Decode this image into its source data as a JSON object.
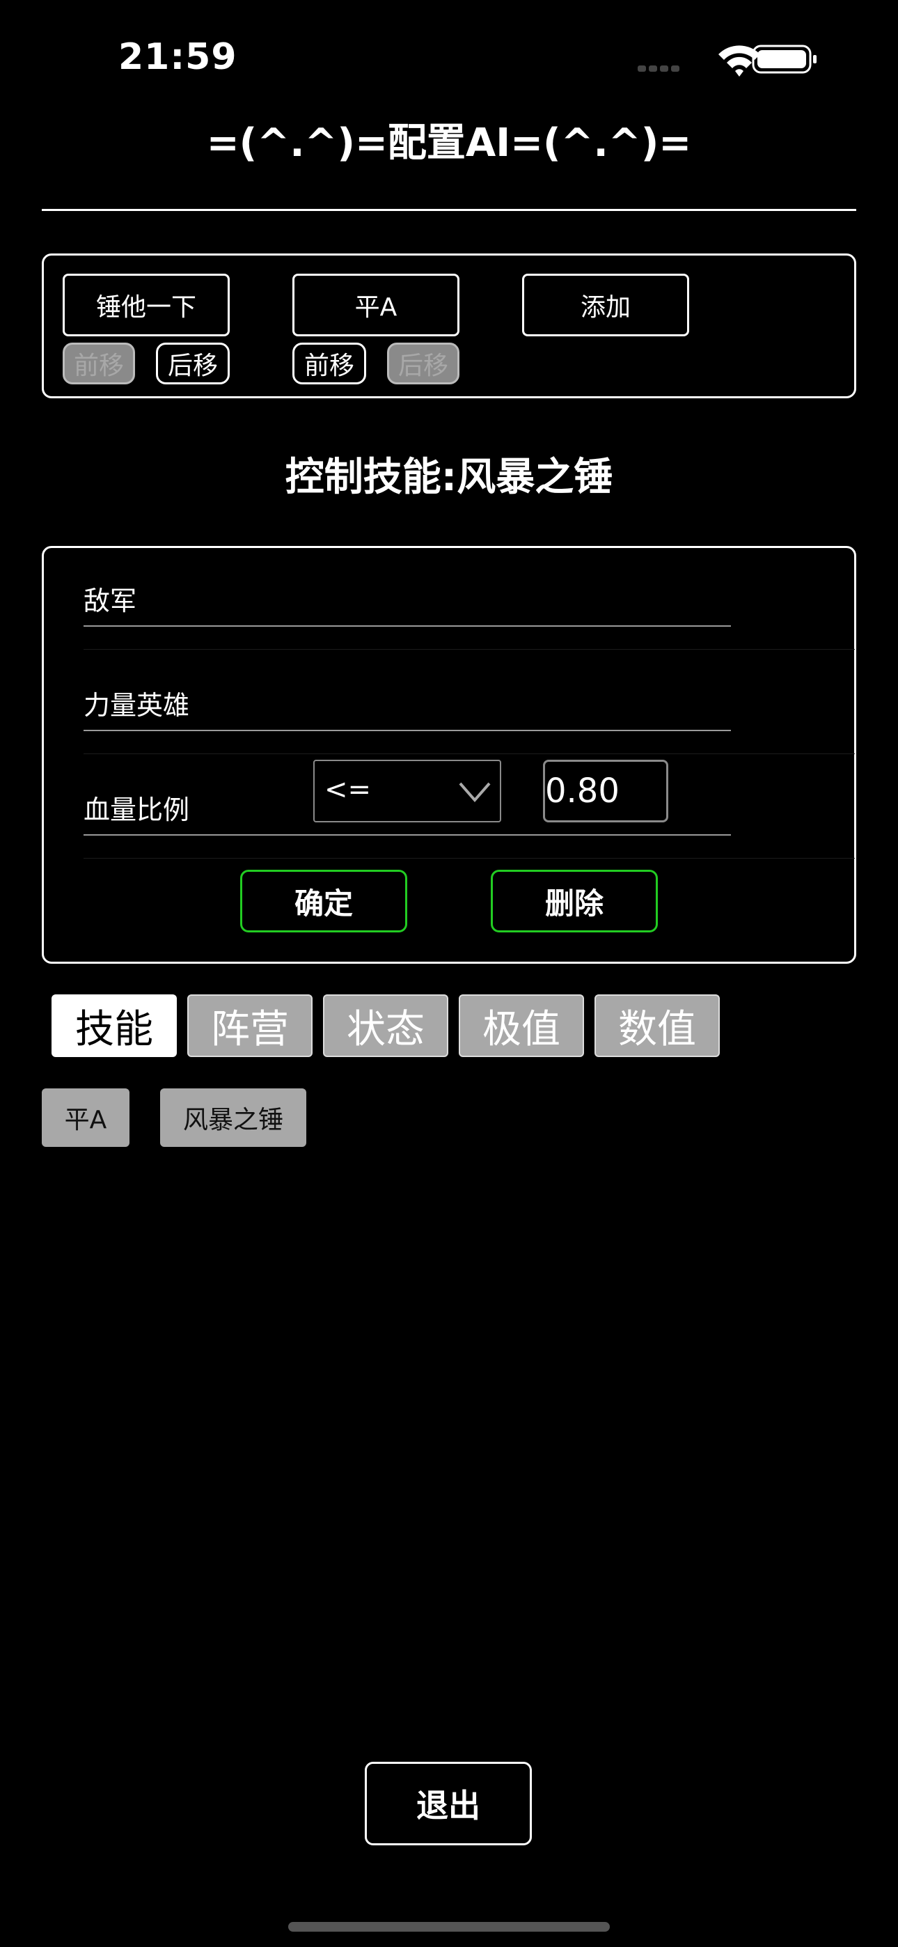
{
  "status_bar": {
    "time": "21:59",
    "icons": [
      "signal-dots-icon",
      "wifi-icon",
      "battery-icon"
    ]
  },
  "header": {
    "title": "=(^.^)=配置AI=(^.^)="
  },
  "ai_list": {
    "items": [
      {
        "label": "锤他一下",
        "move_up": "前移",
        "move_down": "后移",
        "move_up_enabled": false,
        "move_down_enabled": true
      },
      {
        "label": "平A",
        "move_up": "前移",
        "move_down": "后移",
        "move_up_enabled": true,
        "move_down_enabled": false
      }
    ],
    "add_label": "添加"
  },
  "skill": {
    "title": "控制技能:风暴之锤"
  },
  "conditions": {
    "rows": [
      {
        "label": "敌军"
      },
      {
        "label": "力量英雄"
      },
      {
        "label": "血量比例",
        "operator": "<=",
        "value": "0.80"
      }
    ],
    "confirm_label": "确定",
    "delete_label": "删除"
  },
  "tabs": [
    {
      "label": "技能",
      "active": true
    },
    {
      "label": "阵营",
      "active": false
    },
    {
      "label": "状态",
      "active": false
    },
    {
      "label": "极值",
      "active": false
    },
    {
      "label": "数值",
      "active": false
    }
  ],
  "options": [
    {
      "label": "平A"
    },
    {
      "label": "风暴之锤"
    }
  ],
  "footer": {
    "exit_label": "退出"
  },
  "colors": {
    "background": "#000000",
    "foreground": "#ffffff",
    "accent_green": "#22cc22",
    "inactive_gray": "#a8a8a8"
  }
}
